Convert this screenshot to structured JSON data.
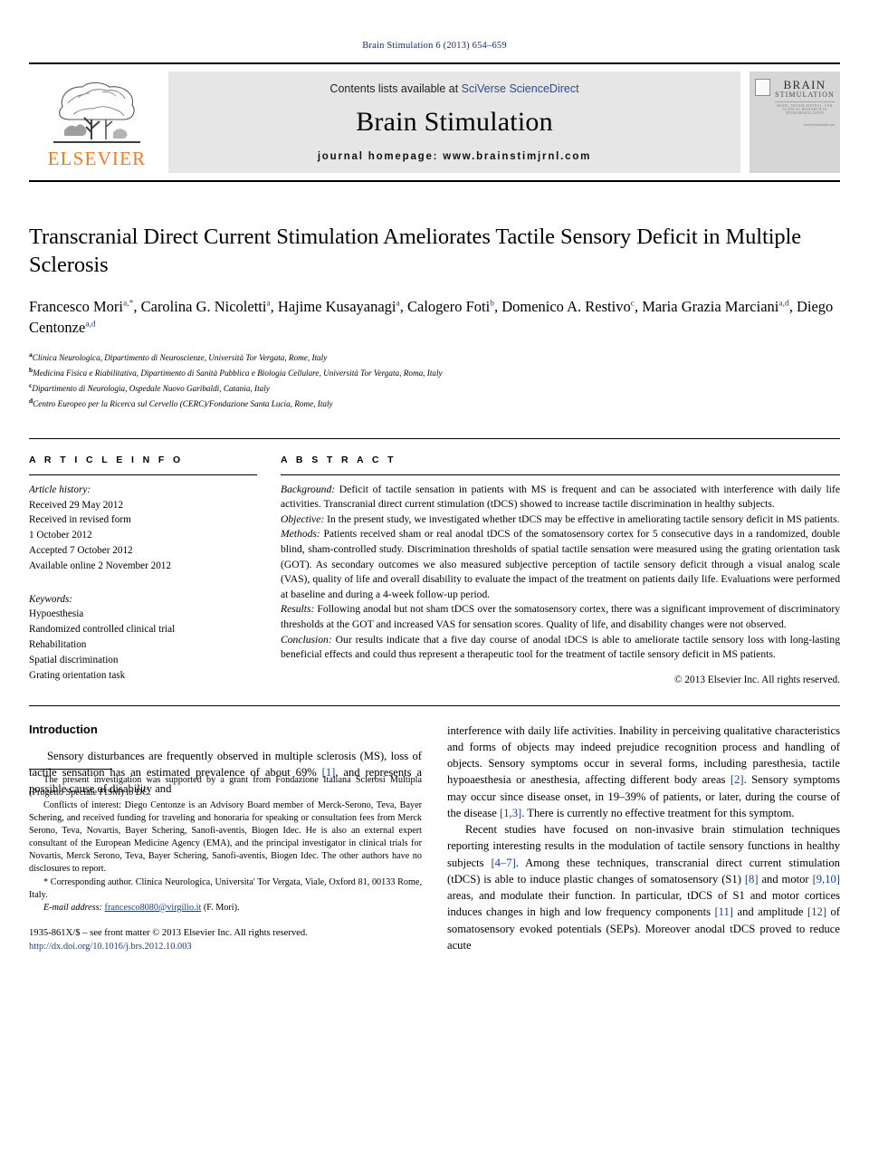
{
  "running_head": "Brain Stimulation 6 (2013) 654–659",
  "masthead": {
    "publisher_name": "ELSEVIER",
    "contents_prefix": "Contents lists available at ",
    "contents_link": "SciVerse ScienceDirect",
    "journal_name": "Brain Stimulation",
    "homepage": "journal homepage: www.brainstimjrnl.com",
    "cover": {
      "line1": "BRAIN",
      "line2": "STIMULATION",
      "tiny": "BASIC, TRANSLATIONAL, AND CLINICAL RESEARCH IN NEUROMODULATION",
      "tiny2": "www.brainstimjrnl.com"
    }
  },
  "article": {
    "title": "Transcranial Direct Current Stimulation Ameliorates Tactile Sensory Deficit in Multiple Sclerosis",
    "authors_line1": "Francesco Mori",
    "authors": [
      {
        "name": "Francesco Mori",
        "sup": "a,*"
      },
      {
        "name": "Carolina G. Nicoletti",
        "sup": "a"
      },
      {
        "name": "Hajime Kusayanagi",
        "sup": "a"
      },
      {
        "name": "Calogero Foti",
        "sup": "b"
      },
      {
        "name": "Domenico A. Restivo",
        "sup": "c"
      },
      {
        "name": "Maria Grazia Marciani",
        "sup": "a,d"
      },
      {
        "name": "Diego Centonze",
        "sup": "a,d"
      }
    ],
    "affiliations": [
      {
        "label": "a",
        "text": "Clinica Neurologica, Dipartimento di Neuroscienze, Università Tor Vergata, Rome, Italy"
      },
      {
        "label": "b",
        "text": "Medicina Fisica e Riabilitativa, Dipartimento di Sanità Pubblica e Biologia Cellulare, Università Tor Vergata, Roma, Italy"
      },
      {
        "label": "c",
        "text": "Dipartimento di Neurologia, Ospedale Nuovo Garibaldi, Catania, Italy"
      },
      {
        "label": "d",
        "text": "Centro Europeo per la Ricerca sul Cervello (CERC)/Fondazione Santa Lucia, Rome, Italy"
      }
    ]
  },
  "article_info": {
    "heading": "A R T I C L E   I N F O",
    "history_title": "Article history:",
    "history": [
      "Received 29 May 2012",
      "Received in revised form",
      "1 October 2012",
      "Accepted 7 October 2012",
      "Available online 2 November 2012"
    ],
    "keywords_title": "Keywords:",
    "keywords": [
      "Hypoesthesia",
      "Randomized controlled clinical trial",
      "Rehabilitation",
      "Spatial discrimination",
      "Grating orientation task"
    ]
  },
  "abstract": {
    "heading": "A B S T R A C T",
    "sections": [
      {
        "label": "Background:",
        "text": " Deficit of tactile sensation in patients with MS is frequent and can be associated with interference with daily life activities. Transcranial direct current stimulation (tDCS) showed to increase tactile discrimination in healthy subjects."
      },
      {
        "label": "Objective:",
        "text": " In the present study, we investigated whether tDCS may be effective in ameliorating tactile sensory deficit in MS patients."
      },
      {
        "label": "Methods:",
        "text": " Patients received sham or real anodal tDCS of the somatosensory cortex for 5 consecutive days in a randomized, double blind, sham-controlled study. Discrimination thresholds of spatial tactile sensation were measured using the grating orientation task (GOT). As secondary outcomes we also measured subjective perception of tactile sensory deficit through a visual analog scale (VAS), quality of life and overall disability to evaluate the impact of the treatment on patients daily life. Evaluations were performed at baseline and during a 4-week follow-up period."
      },
      {
        "label": "Results:",
        "text": " Following anodal but not sham tDCS over the somatosensory cortex, there was a significant improvement of discriminatory thresholds at the GOT and increased VAS for sensation scores. Quality of life, and disability changes were not observed."
      },
      {
        "label": "Conclusion:",
        "text": " Our results indicate that a five day course of anodal tDCS is able to ameliorate tactile sensory loss with long-lasting beneficial effects and could thus represent a therapeutic tool for the treatment of tactile sensory deficit in MS patients."
      }
    ],
    "copyright": "© 2013 Elsevier Inc. All rights reserved."
  },
  "body": {
    "intro_heading": "Introduction",
    "left_paragraph": "Sensory disturbances are frequently observed in multiple sclerosis (MS), loss of tactile sensation has an estimated prevalence of about 69% [1], and represents a possible cause of disability and",
    "right_paragraph_1": "interference with daily life activities. Inability in perceiving qualitative characteristics and forms of objects may indeed prejudice recognition process and handling of objects. Sensory symptoms occur in several forms, including paresthesia, tactile hypoaesthesia or anesthesia, affecting different body areas [2]. Sensory symptoms may occur since disease onset, in 19–39% of patients, or later, during the course of the disease [1,3]. There is currently no effective treatment for this symptom.",
    "right_paragraph_2": "Recent studies have focused on non-invasive brain stimulation techniques reporting interesting results in the modulation of tactile sensory functions in healthy subjects [4–7]. Among these techniques, transcranial direct current stimulation (tDCS) is able to induce plastic changes of somatosensory (S1) [8] and motor [9,10] areas, and modulate their function. In particular, tDCS of S1 and motor cortices induces changes in high and low frequency components [11] and amplitude [12] of somatosensory evoked potentials (SEPs). Moreover anodal tDCS proved to reduce acute"
  },
  "footnotes": {
    "grant": "The present investigation was supported by a grant from Fondazione Italiana Sclerosi Multipla (Progetto Speciale FISM) to DC.",
    "conflicts": "Conflicts of interest: Diego Centonze is an Advisory Board member of Merck-Serono, Teva, Bayer Schering, and received funding for traveling and honoraria for speaking or consultation fees from Merck Serono, Teva, Novartis, Bayer Schering, Sanofi-aventis, Biogen Idec. He is also an external expert consultant of the European Medicine Agency (EMA), and the principal investigator in clinical trials for Novartis, Merck Serono, Teva, Bayer Schering, Sanofi-aventis, Biogen Idec. The other authors have no disclosures to report.",
    "corresponding": "* Corresponding author. Clinica Neurologica, Universita' Tor Vergata, Viale, Oxford 81, 00133 Rome, Italy.",
    "email_label": "E-mail address:",
    "email": "francesco8080@virgilio.it",
    "email_suffix": " (F. Mori).",
    "issn": "1935-861X/$ – see front matter © 2013 Elsevier Inc. All rights reserved.",
    "doi": "http://dx.doi.org/10.1016/j.brs.2012.10.003"
  },
  "colors": {
    "link": "#1a3e8c",
    "elsevier_orange": "#F47920",
    "panel_gray": "#e6e6e6"
  }
}
